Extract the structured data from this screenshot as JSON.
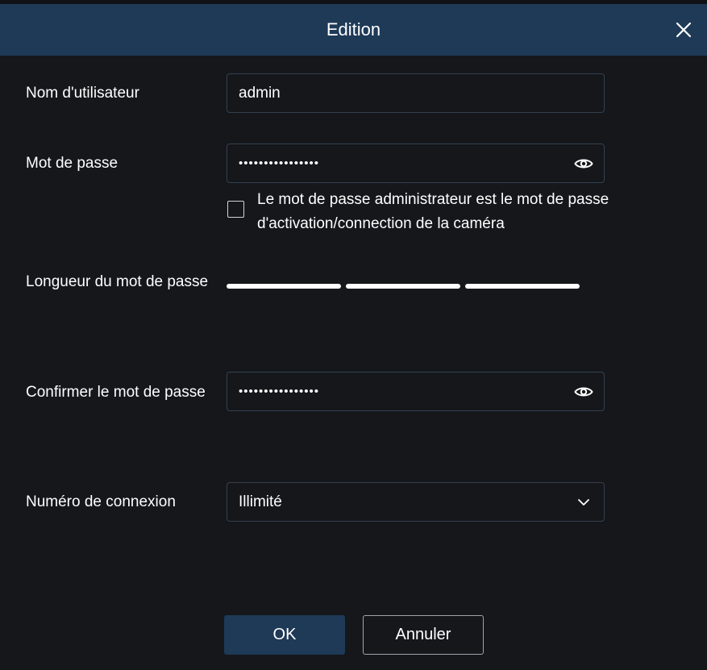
{
  "dialog": {
    "title": "Edition",
    "close_icon": "close-icon"
  },
  "form": {
    "username": {
      "label": "Nom d'utilisateur",
      "value": "admin"
    },
    "password": {
      "label": "Mot de passe",
      "value": "••••••••••••••••",
      "toggle_icon": "eye-icon"
    },
    "admin_checkbox": {
      "checked": false,
      "text": "Le mot de passe administrateur est le mot de passe d'activation/connection de la caméra"
    },
    "password_length": {
      "label": "Longueur du mot de passe",
      "segments": 3
    },
    "confirm_password": {
      "label": "Confirmer le mot de passe",
      "value": "••••••••••••••••",
      "toggle_icon": "eye-icon"
    },
    "connection_number": {
      "label": "Numéro de connexion",
      "value": "Illimité",
      "dropdown_icon": "chevron-down-icon"
    }
  },
  "buttons": {
    "ok_label": "OK",
    "cancel_label": "Annuler"
  },
  "colors": {
    "header": "#1e3a57",
    "background": "#15171b",
    "field_border": "#34414f"
  }
}
